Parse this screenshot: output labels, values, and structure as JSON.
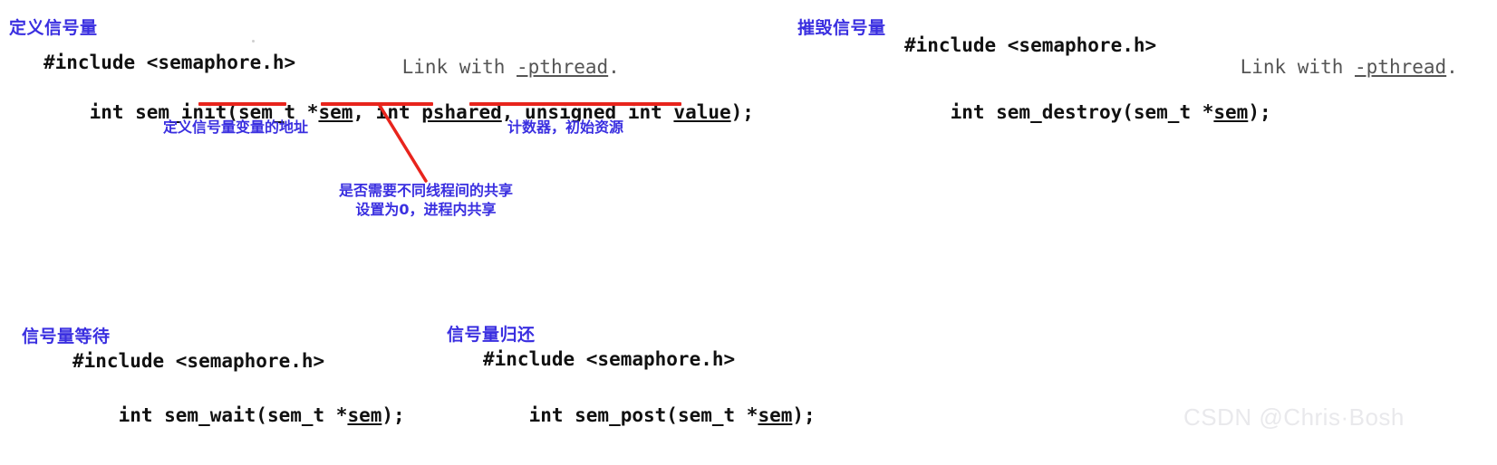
{
  "page": {
    "background": "#ffffff",
    "accent_blue": "#3a2fe0",
    "accent_red": "#e8241c",
    "code_color": "#111111"
  },
  "sections": {
    "define": {
      "label": "定义信号量",
      "include_line": "#include <semaphore.h>",
      "link_note": "Link with -pthread.",
      "signature": {
        "part1": "int sem_init(sem_t *",
        "u1": "sem",
        "part2": ", int ",
        "u2": "pshared",
        "part3": ", unsigned int ",
        "u3": "value",
        "part4": ");"
      },
      "annotations": {
        "address": "定义信号量变量的地址",
        "counter": "计数器，初始资源",
        "pshared_line1": "是否需要不同线程间的共享",
        "pshared_line2": "设置为0，进程内共享"
      }
    },
    "destroy": {
      "label": "摧毁信号量",
      "include_line": "#include <semaphore.h>",
      "link_note": "Link with -pthread.",
      "signature": {
        "part1": "int sem_destroy(sem_t *",
        "u1": "sem",
        "part4": ");"
      }
    },
    "wait": {
      "label": "信号量等待",
      "include_line": "#include <semaphore.h>",
      "signature": {
        "part1": "int sem_wait(sem_t *",
        "u1": "sem",
        "part4": ");"
      }
    },
    "post": {
      "label": "信号量归还",
      "include_line": "#include <semaphore.h>",
      "signature": {
        "part1": "int sem_post(sem_t *",
        "u1": "sem",
        "part4": ");"
      }
    }
  },
  "watermark": {
    "text": "CSDN @Chris·Bosh"
  }
}
